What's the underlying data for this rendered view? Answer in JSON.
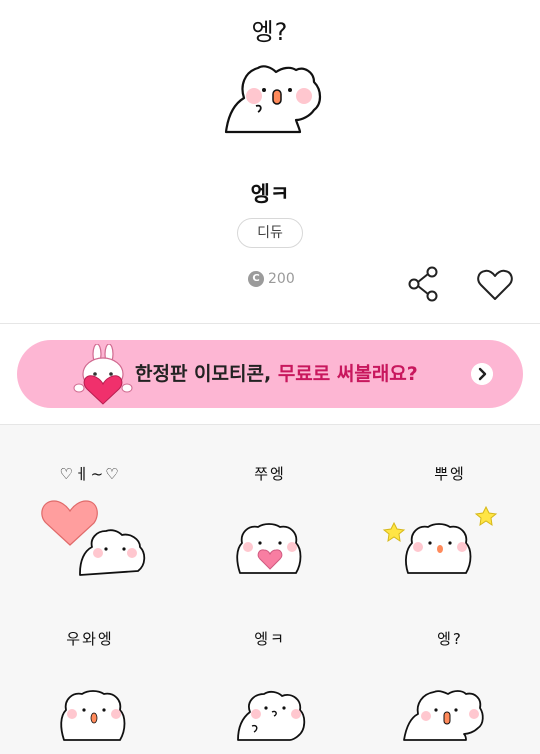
{
  "hero": {
    "caption": "엥?",
    "sticker_icon": "bunny-surprised-sticker"
  },
  "product": {
    "title": "엥ㅋ",
    "author": "디듀",
    "price": "200",
    "coin_symbol": "C",
    "coin_icon": "coin-icon",
    "share_icon": "share-icon",
    "like_icon": "heart-outline-icon"
  },
  "promo": {
    "text_main": "한정판 이모티콘, ",
    "text_highlight": "무료로 써볼래요?",
    "bg_color": "#fdb6d3",
    "highlight_color": "#c8175d",
    "arrow_icon": "chevron-right-icon"
  },
  "grid": [
    {
      "caption": "♡ㅔ~♡"
    },
    {
      "caption": "쭈엥"
    },
    {
      "caption": "뿌엥"
    },
    {
      "caption": "우와엥"
    },
    {
      "caption": "엥ㅋ"
    },
    {
      "caption": "엥?"
    }
  ]
}
